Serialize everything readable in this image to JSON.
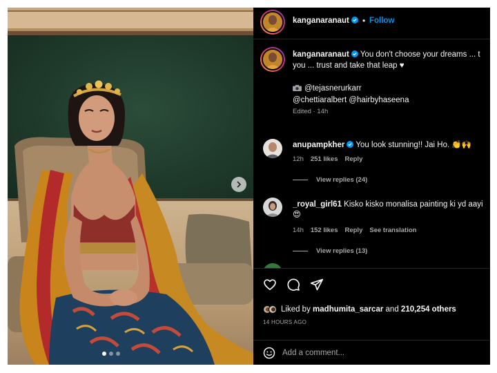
{
  "post": {
    "author": {
      "username": "kanganaranaut",
      "verified": true,
      "follow_label": "Follow",
      "separator": "•"
    },
    "image": {
      "carousel_dots": 3,
      "active_dot": 0,
      "next_icon": "chevron-right-icon"
    },
    "caption": {
      "username": "kanganaranaut",
      "text_line1": "You don't choose your dreams ... t",
      "text_line2": "you ... trust and take that leap ♥",
      "credits_line1": "@tejasnerurkarr",
      "credits_line2": "@chettiaralbert @hairbyhaseena",
      "camera_icon": "camera-icon",
      "meta": "Edited · 14h"
    },
    "comments": [
      {
        "username": "anupampkher",
        "verified": true,
        "text": "You look stunning!! Jai Ho. 👏🙌",
        "time": "12h",
        "likes": "251 likes",
        "reply_label": "Reply",
        "translation_label": "",
        "view_replies": "View replies (24)"
      },
      {
        "username": "_royal_girl61",
        "verified": false,
        "text": "Kisko kisko monalisa painting ki yd aayi",
        "text_line2": "😍",
        "time": "14h",
        "likes": "152 likes",
        "reply_label": "Reply",
        "translation_label": "See translation",
        "view_replies": "View replies (13)"
      }
    ],
    "actions": {
      "like_icon": "heart-icon",
      "comment_icon": "comment-icon",
      "share_icon": "share-icon"
    },
    "likes": {
      "prefix": "Liked by",
      "user": "madhumita_sarcar",
      "connector": "and",
      "others": "210,254 others"
    },
    "timestamp": "14 HOURS AGO",
    "add_comment": {
      "placeholder": "Add a comment...",
      "emoji_icon": "smiley-icon"
    },
    "colors": {
      "background": "#000000",
      "link_blue": "#0095f6",
      "muted": "#a8a8a8",
      "text": "#f5f5f5"
    }
  }
}
